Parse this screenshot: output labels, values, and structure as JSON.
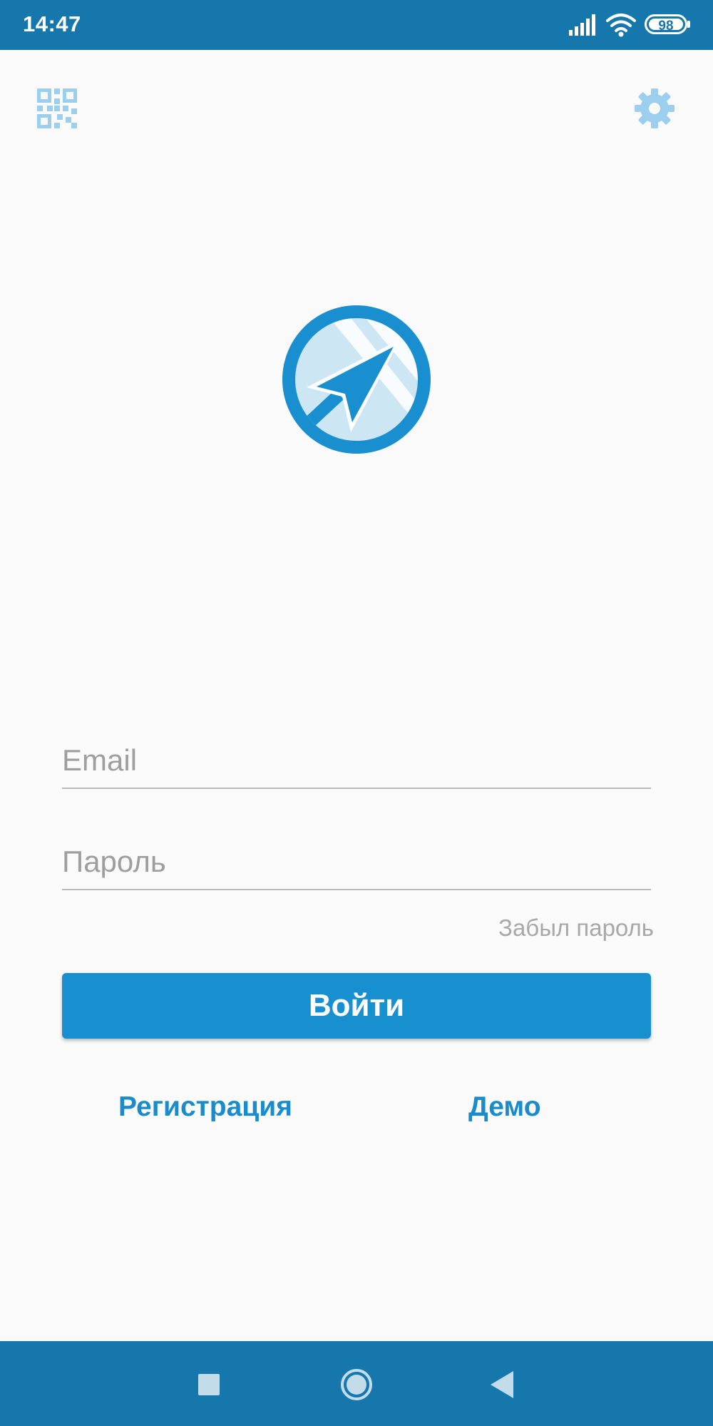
{
  "status_bar": {
    "time": "14:47",
    "battery_level": "98",
    "icons": [
      "signal-icon",
      "wifi-icon",
      "battery-icon"
    ]
  },
  "top_bar": {
    "left_icon": "qr-code-icon",
    "right_icon": "gear-icon"
  },
  "logo": {
    "icon": "navigation-arrow-logo"
  },
  "form": {
    "email_placeholder": "Email",
    "email_value": "",
    "password_placeholder": "Пароль",
    "password_value": "",
    "forgot_password_label": "Забыл пароль",
    "login_label": "Войти",
    "register_label": "Регистрация",
    "demo_label": "Демо"
  },
  "nav_bar": {
    "icons": [
      "recent-apps-icon",
      "home-icon",
      "back-icon"
    ]
  },
  "colors": {
    "status_bar": "#1677ad",
    "accent": "#1890cf",
    "link": "#1a8bcb",
    "icon_light": "#9bcfed",
    "background": "#fafafa"
  }
}
